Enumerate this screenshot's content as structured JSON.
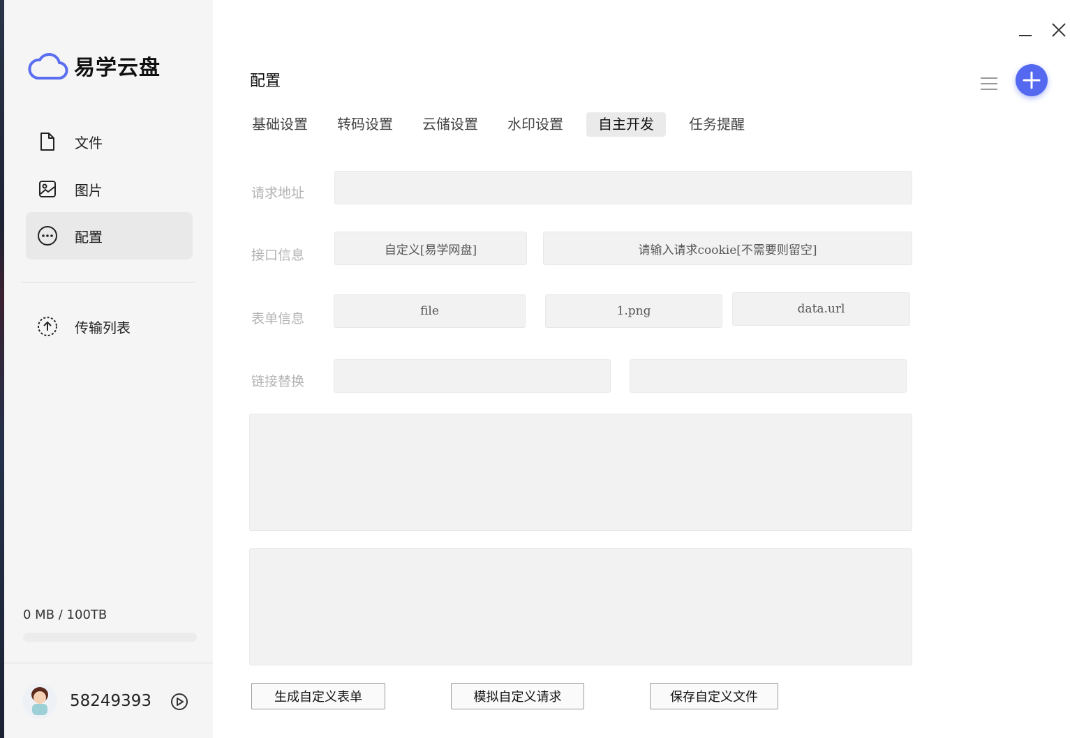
{
  "app": {
    "name": "易学云盘"
  },
  "sidebar": {
    "items": [
      {
        "label": "文件",
        "icon": "file-icon"
      },
      {
        "label": "图片",
        "icon": "image-icon"
      },
      {
        "label": "配置",
        "icon": "more-circle-icon",
        "active": true
      },
      {
        "label": "传输列表",
        "icon": "upload-circle-icon"
      }
    ],
    "storage": {
      "text": "0 MB / 100TB",
      "used_fraction": 0.0
    },
    "user": {
      "id": "58249393"
    }
  },
  "main": {
    "title": "配置",
    "tabs": [
      {
        "label": "基础设置"
      },
      {
        "label": "转码设置"
      },
      {
        "label": "云储设置"
      },
      {
        "label": "水印设置"
      },
      {
        "label": "自主开发",
        "active": true
      },
      {
        "label": "任务提醒"
      }
    ],
    "form": {
      "request_url_label": "请求地址",
      "request_url_value": "",
      "api_info_label": "接口信息",
      "api_info_name": "自定义[易学网盘]",
      "api_info_cookie": "请输入请求cookie[不需要则留空]",
      "form_info_label": "表单信息",
      "form_field": "file",
      "form_filename": "1.png",
      "form_result": "data.url",
      "link_replace_label": "链接替换",
      "link_replace_from": "",
      "link_replace_to": ""
    },
    "buttons": {
      "generate": "生成自定义表单",
      "simulate": "模拟自定义请求",
      "save": "保存自定义文件"
    }
  },
  "colors": {
    "accent": "#5468f0",
    "sidebar_bg": "#f5f5f5",
    "field_bg": "#f2f2f2",
    "label": "#b3b3b3"
  }
}
